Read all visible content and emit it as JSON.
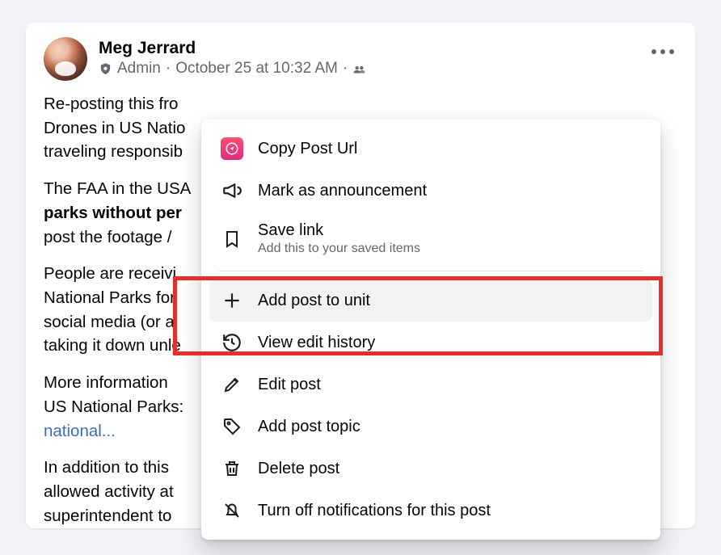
{
  "author": {
    "name": "Meg Jerrard",
    "role": "Admin",
    "timestamp": "October 25 at 10:32 AM"
  },
  "body": {
    "p1a": "Re-posting this fro",
    "p1b": "Drones in US Natio",
    "p1c": "traveling responsib",
    "p2a": "The FAA in the USA",
    "p2b_bold": "parks without per",
    "p2c": "post the footage /",
    "p3a": "People are receivi",
    "p3b": "National Parks for",
    "p3c": "social media (or a",
    "p3d": "taking it down unle",
    "p4a": "More information ",
    "p4b": "US National Parks:",
    "p4c_link": "national...",
    "p5a": "In addition to this",
    "p5b": "allowed activity at",
    "p5c": "superintendent to"
  },
  "menu": {
    "copy": "Copy Post Url",
    "announce": "Mark as announcement",
    "save": "Save link",
    "save_sub": "Add this to your saved items",
    "add_unit": "Add post to unit",
    "history": "View edit history",
    "edit": "Edit post",
    "topic": "Add post topic",
    "delete": "Delete post",
    "notifications": "Turn off notifications for this post"
  }
}
